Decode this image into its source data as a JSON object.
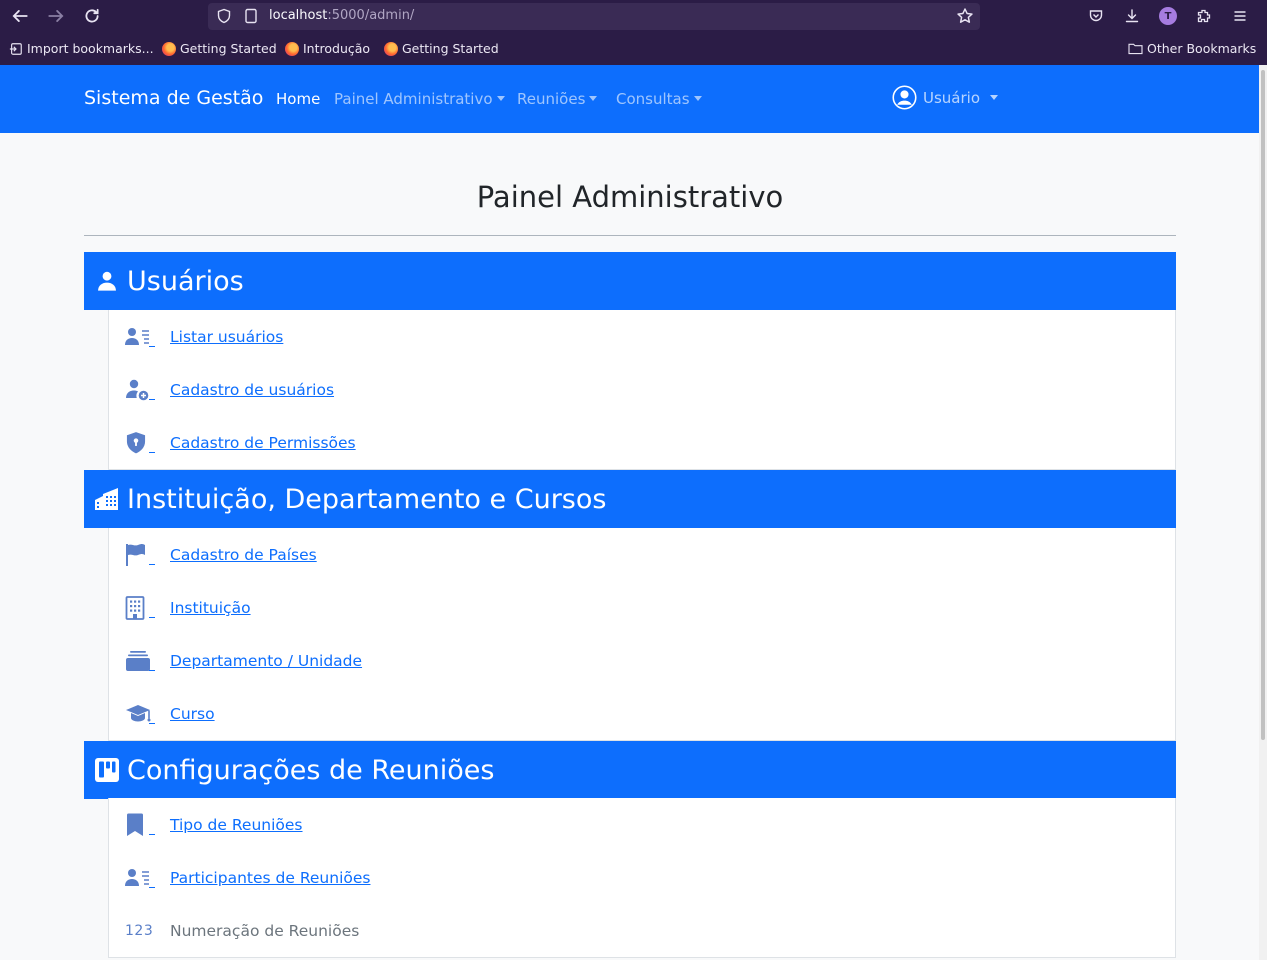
{
  "browser": {
    "url_host": "localhost",
    "url_rest": ":5000/admin/",
    "avatar_letter": "T",
    "bookmarks": [
      "Import bookmarks...",
      "Getting Started",
      "Introdução",
      "Getting Started"
    ],
    "other_bookmarks": "Other Bookmarks"
  },
  "navbar": {
    "brand": "Sistema de Gestão",
    "links": [
      "Home",
      "Painel Administrativo",
      "Reuniões",
      "Consultas"
    ],
    "user": "Usuário",
    "color": "#0d6efd"
  },
  "main": {
    "title": "Painel Administrativo",
    "sections": [
      {
        "title": "Usuários",
        "icon": "person-icon",
        "items": [
          {
            "label": "Listar usuários",
            "icon": "person-lines-icon"
          },
          {
            "label": "Cadastro de usuários",
            "icon": "person-add-icon"
          },
          {
            "label": "Cadastro de Permissões",
            "icon": "shield-lock-icon"
          }
        ]
      },
      {
        "title": "Instituição, Departamento e Cursos",
        "icon": "buildings-icon",
        "items": [
          {
            "label": "Cadastro de Países",
            "icon": "flag-icon"
          },
          {
            "label": "Instituição",
            "icon": "building-icon"
          },
          {
            "label": "Departamento / Unidade",
            "icon": "collection-icon"
          },
          {
            "label": "Curso",
            "icon": "mortarboard-icon"
          }
        ]
      },
      {
        "title": "Configurações de Reuniões",
        "icon": "kanban-icon",
        "items": [
          {
            "label": "Tipo de Reuniões",
            "icon": "bookmark-icon"
          },
          {
            "label": "Participantes de Reuniões",
            "icon": "person-lines-icon"
          },
          {
            "label": "Numeração de Reuniões",
            "icon": "123-icon",
            "icon_text": "123"
          }
        ]
      }
    ]
  }
}
